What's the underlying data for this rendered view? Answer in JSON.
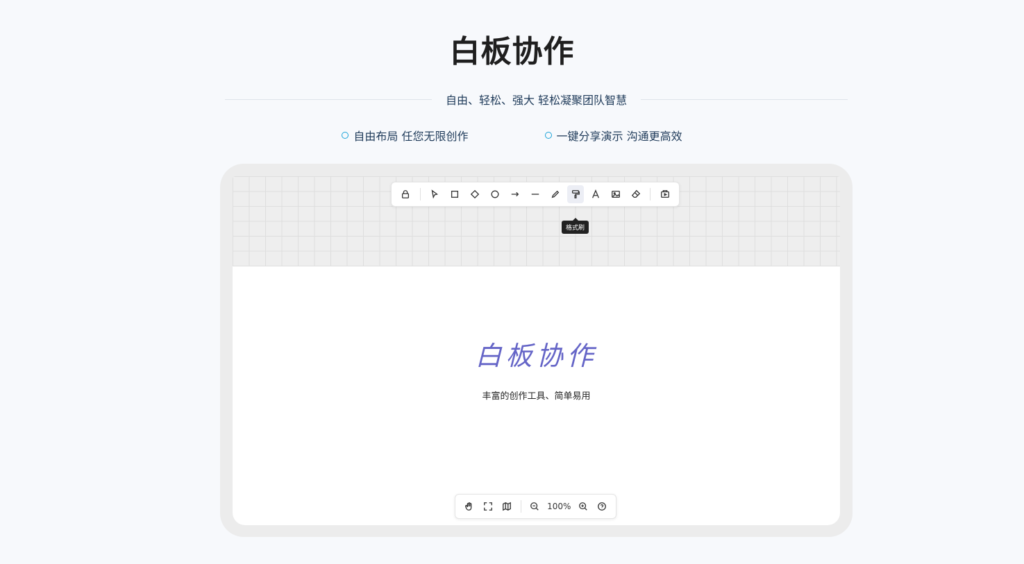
{
  "hero": {
    "title": "白板协作",
    "subtitle": "自由、轻松、强大 轻松凝聚团队智慧",
    "features": [
      "自由布局 任您无限创作",
      "一键分享演示 沟通更高效"
    ]
  },
  "accent": "#1aa3d9",
  "whiteboard": {
    "top_toolbar": {
      "tools": [
        "lock-icon",
        "select-cursor-icon",
        "rectangle-icon",
        "diamond-icon",
        "circle-icon",
        "arrow-icon",
        "line-icon",
        "pencil-icon",
        "format-brush-icon",
        "text-icon",
        "image-icon",
        "eraser-icon",
        "present-icon"
      ],
      "active_tool": "format-brush-icon",
      "tooltip": "格式刷"
    },
    "bottom_toolbar": {
      "tools": [
        "hand-icon",
        "fullscreen-icon",
        "minimap-icon",
        "zoom-out-icon",
        "zoom-in-icon",
        "help-icon"
      ],
      "zoom": "100%"
    },
    "canvas": {
      "heading": "白板协作",
      "heading_color": "#6565c7",
      "subtext": "丰富的创作工具、简单易用"
    }
  }
}
